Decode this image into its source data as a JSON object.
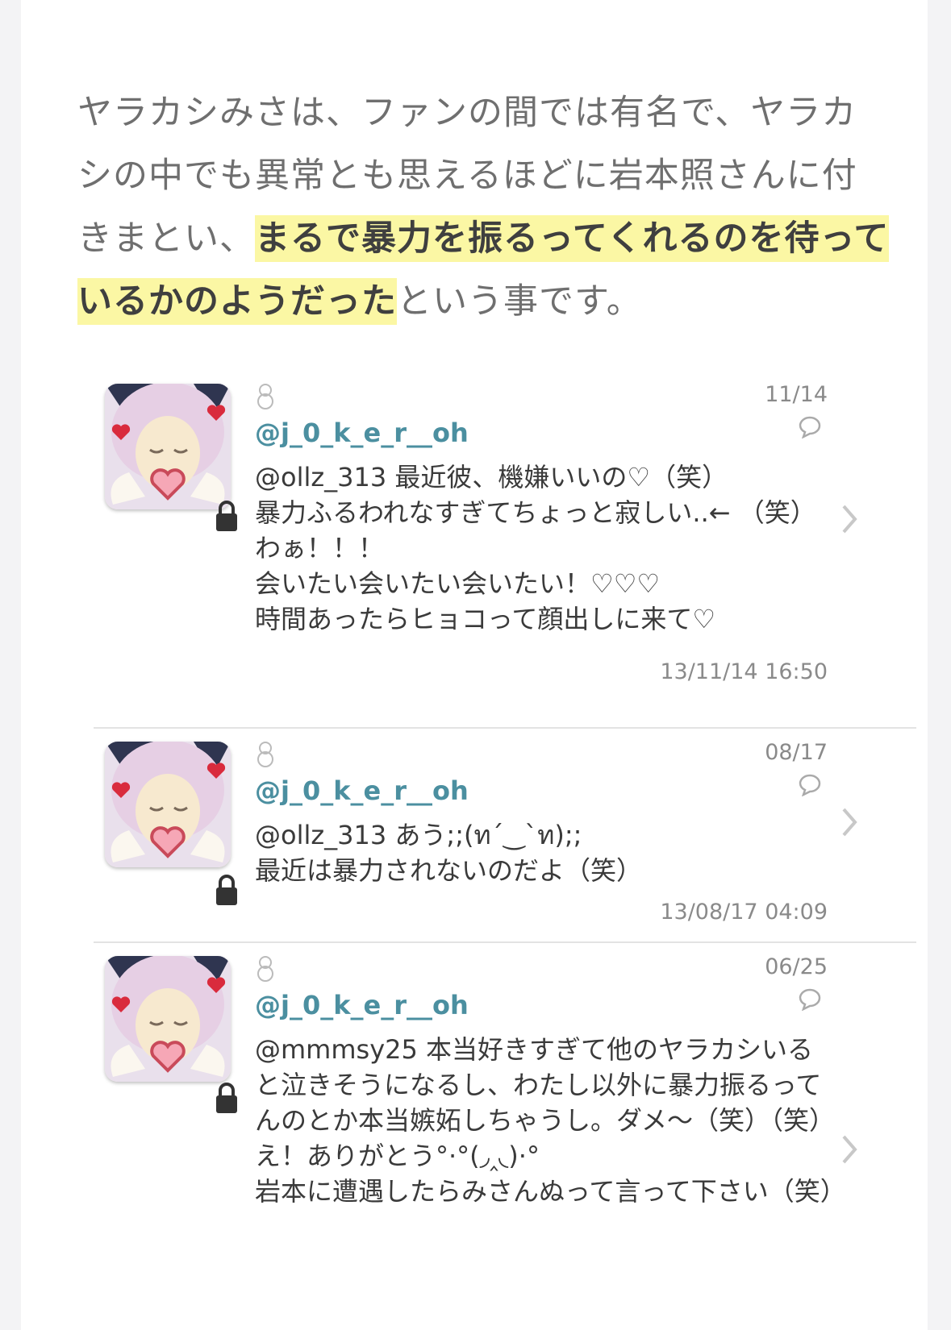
{
  "article": {
    "text_before": "ヤラカシみさは、ファンの間では有名で、ヤラカシの中でも異常とも思えるほどに岩本照さんに付きまとい、",
    "highlight": "まるで暴力を振るってくれるのを待っているかのようだった",
    "text_after": "という事です。"
  },
  "tweets": [
    {
      "username": "@j_0_k_e_r__oh",
      "date": "11/14",
      "body": "@ollz_313 最近彼、機嫌いいの♡（笑）\n暴力ふるわれなすぎてちょっと寂しい..← （笑）\nわぁ！！！\n会いたい会いたい会いたい！♡♡♡\n時間あったらヒョコって顔出しに来て♡",
      "timestamp": "13/11/14 16:50"
    },
    {
      "username": "@j_0_k_e_r__oh",
      "date": "08/17",
      "body": "@ollz_313 あう;;(ท´‿`ท);;\n最近は暴力されないのだよ（笑）",
      "timestamp": "13/08/17 04:09"
    },
    {
      "username": "@j_0_k_e_r__oh",
      "date": "06/25",
      "body": "@mmmsy25 本当好きすぎて他のヤラカシいると泣きそうになるし、わたし以外に暴力振るってんのとか本当嫉妬しちゃうし。ダメ〜（笑）（笑）\nえ！ありがとう°·°(◞‸◟)·°\n岩本に遭遇したらみさんぬって言って下さい（笑）",
      "timestamp": ""
    }
  ],
  "colors": {
    "highlight_bg": "#fbf7a4",
    "username": "#4b8fa0",
    "muted": "#8a8a8a"
  },
  "icons": {
    "avatar": "anime-girl-avatar",
    "lock": "lock-icon",
    "snow": "snowman-icon",
    "reply": "conversation-icon",
    "chevron": "chevron-right-icon"
  }
}
